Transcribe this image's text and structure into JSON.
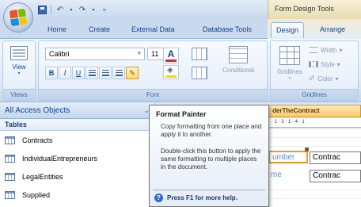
{
  "titlebar": {
    "contextual_group": "Form Design Tools",
    "qat_icons": [
      "save-icon",
      "undo-icon",
      "redo-icon",
      "customize-icon"
    ]
  },
  "tabs": [
    "Home",
    "Create",
    "External Data",
    "Database Tools",
    "Design",
    "Arrange"
  ],
  "active_tab": "Design",
  "ribbon": {
    "views": {
      "view_label": "View",
      "group_label": "Views"
    },
    "font": {
      "font_name": "Calibri",
      "font_size": "11",
      "bold": "B",
      "italic": "I",
      "underline": "U",
      "color_letter": "A",
      "conditional_label": "Conditional",
      "group_label": "Font"
    },
    "gridlines": {
      "gridlines_label": "Gridlines",
      "width_label": "Width",
      "style_label": "Style",
      "color_label": "Color",
      "group_label": "Gridlines"
    }
  },
  "nav": {
    "header": "All Access Objects",
    "group": "Tables",
    "items": [
      "Contracts",
      "IndividualEntrepreneurs",
      "LegalEntities",
      "Supplied"
    ]
  },
  "doc": {
    "tab_title": "derTheContract",
    "ruler": "· 1 · 3 · 1 · 4 · 1",
    "controls": {
      "label1": "umber",
      "box1": "Contrac",
      "label2": "me",
      "box2": "Contrac"
    }
  },
  "tooltip": {
    "title": "Format Painter",
    "body1": "Copy formatting from one place and apply it to another.",
    "body2": "Double-click this button to apply the same formatting to multiple places in the document.",
    "help": "Press F1 for more help."
  },
  "colors": {
    "ribbon_blue": "#15428b",
    "context_gold": "#e9dcb2",
    "selection_orange": "#e59e2b"
  }
}
